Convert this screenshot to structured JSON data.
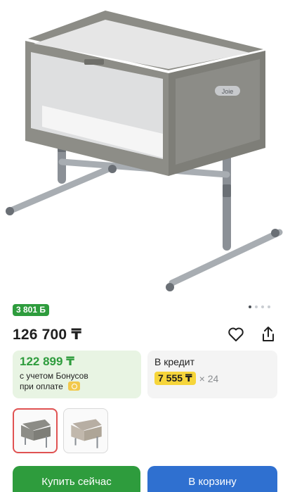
{
  "product": {
    "image_alt": "bedside crib",
    "brand_mark": "Joie",
    "bonus_badge": "3 801 Б",
    "price": "126 700 ₸"
  },
  "gallery": {
    "active_index": 0,
    "dot_count": 4
  },
  "icons": {
    "favorite": "heart-icon",
    "share": "share-icon",
    "coin": "bonus-coin-icon"
  },
  "bonus_offer": {
    "price": "122 899 ₸",
    "note_line1": "с учетом Бонусов",
    "note_line2": "при оплате"
  },
  "credit_offer": {
    "title": "В кредит",
    "monthly": "7 555 ₸",
    "times": "× 24"
  },
  "actions": {
    "buy_now": "Купить сейчас",
    "add_to_cart": "В корзину"
  },
  "colors": {
    "green": "#2e9c3d",
    "blue": "#2f70d0",
    "yellow": "#f6d53a",
    "selected_thumb_border": "#e05252"
  }
}
